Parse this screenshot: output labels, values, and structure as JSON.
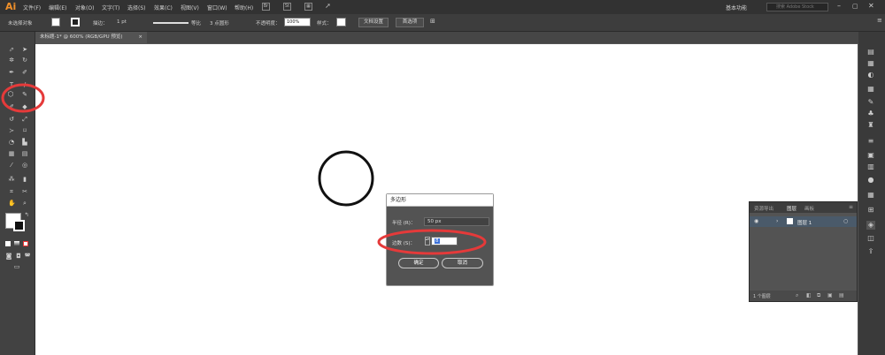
{
  "app": {
    "logo": "Ai"
  },
  "menu": {
    "items": [
      "文件(F)",
      "编辑(E)",
      "对象(O)",
      "文字(T)",
      "选择(S)",
      "效果(C)",
      "视图(V)",
      "窗口(W)",
      "帮助(H)"
    ]
  },
  "workspace": {
    "label": "基本功能",
    "search_placeholder": "搜索 Adobe Stock"
  },
  "control_bar": {
    "selection_status": "未选择对象",
    "stroke_label": "描边：",
    "stroke_weight": "1 pt",
    "stroke_profile": "等比",
    "brush": "3 点圆形",
    "opacity_label": "不透明度：",
    "opacity_value": "100%",
    "style_label": "样式：",
    "doc_setup_button": "文档设置",
    "preferences_button": "首选项"
  },
  "document_tab": {
    "title": "未标题-1* @ 600% (RGB/GPU 预览)",
    "close": "×"
  },
  "dialog": {
    "title": "多边形",
    "radius_label": "半径 (R)：",
    "radius_value": "50 px",
    "sides_label": "边数 (S)：",
    "sides_value": "8",
    "ok_button": "确定",
    "cancel_button": "取消"
  },
  "layers_panel": {
    "tabs": [
      "资源导出",
      "图层",
      "画板"
    ],
    "layer_name": "图层 1",
    "footer_count": "1 个图层"
  },
  "colors": {
    "highlight": "#e53a3a",
    "accent": "#f0902a"
  }
}
